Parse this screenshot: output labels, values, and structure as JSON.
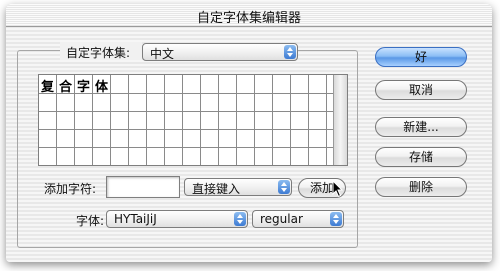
{
  "window": {
    "title": "自定字体集编辑器"
  },
  "charset": {
    "label": "自定字体集:",
    "value": "中文"
  },
  "grid": {
    "characters": [
      "复",
      "合",
      "字",
      "体"
    ]
  },
  "add_char": {
    "label": "添加字符:",
    "value": "",
    "mode_value": "直接键入",
    "add_button": "添加"
  },
  "font": {
    "label": "字体:",
    "family_value": "HYTaiJiJ",
    "style_value": "regular"
  },
  "buttons": {
    "ok": "好",
    "cancel": "取消",
    "new": "新建...",
    "save": "存储",
    "delete": "删除"
  }
}
